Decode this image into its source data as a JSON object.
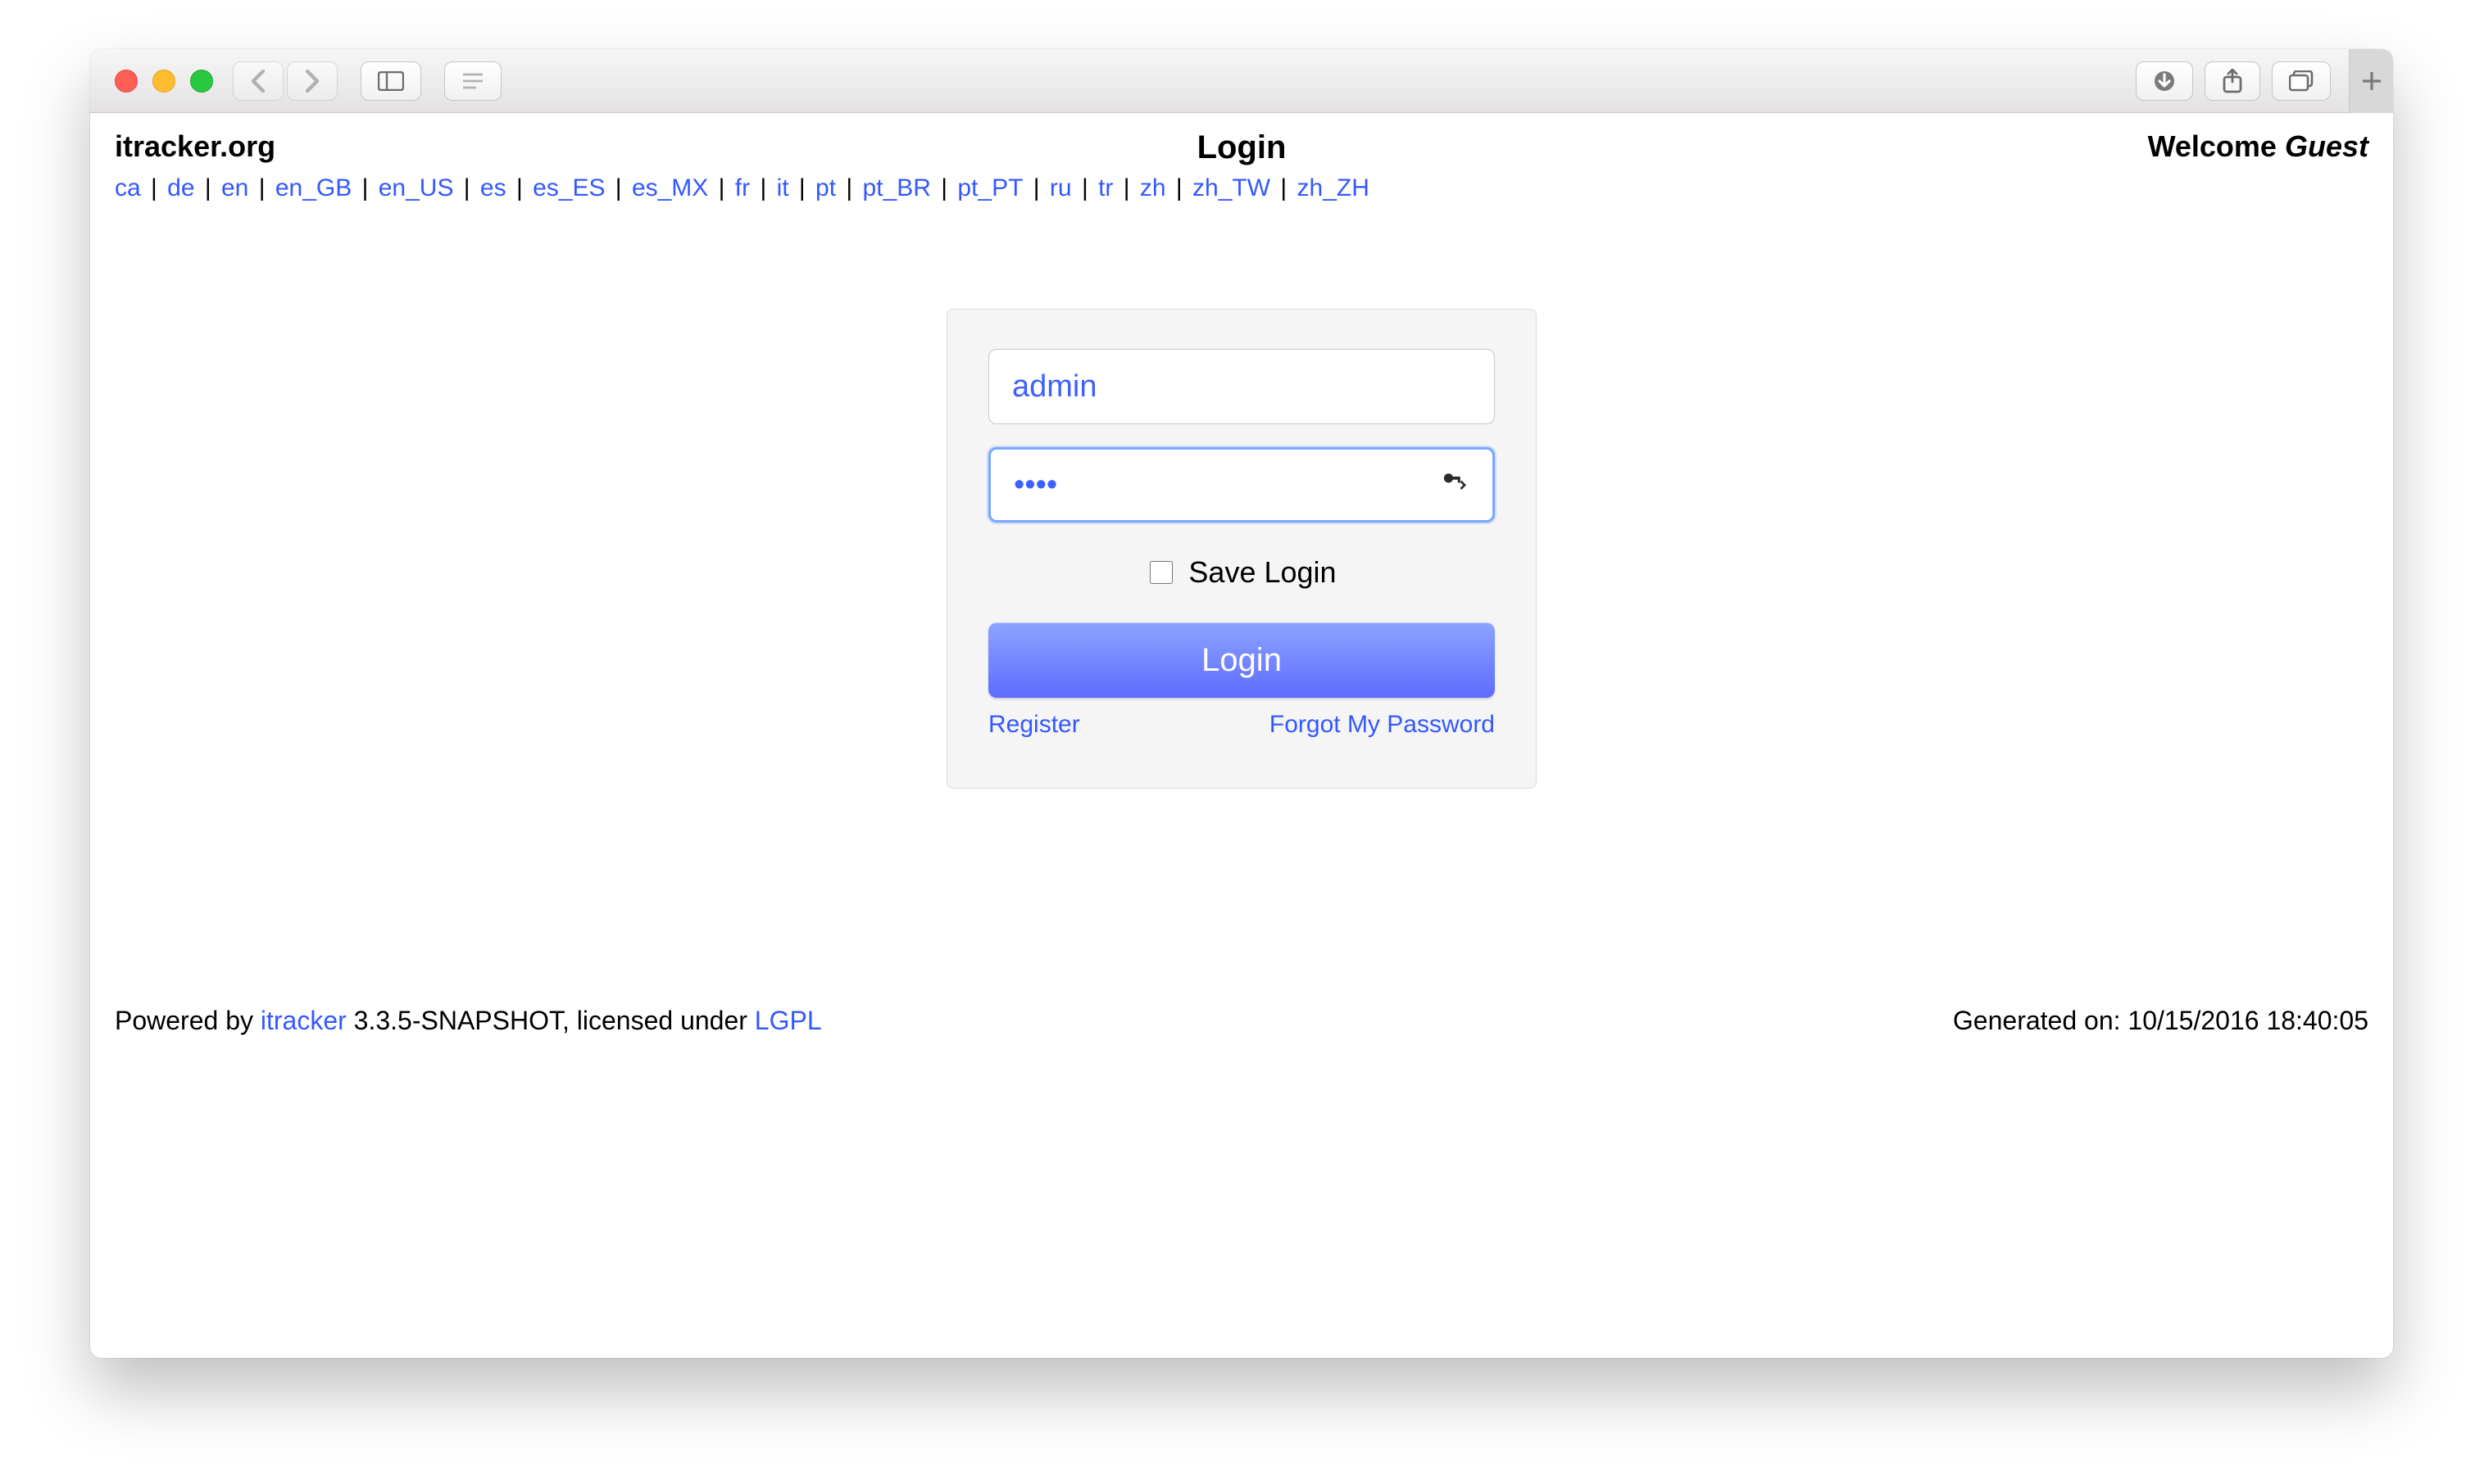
{
  "site": {
    "title": "itracker.org"
  },
  "page": {
    "title": "Login"
  },
  "welcome": {
    "prefix": "Welcome ",
    "user": "Guest"
  },
  "locales": [
    "ca",
    "de",
    "en",
    "en_GB",
    "en_US",
    "es",
    "es_ES",
    "es_MX",
    "fr",
    "it",
    "pt",
    "pt_BR",
    "pt_PT",
    "ru",
    "tr",
    "zh",
    "zh_TW",
    "zh_ZH"
  ],
  "login": {
    "username_value": "admin",
    "password_value": "••••",
    "save_label": "Save Login",
    "submit_label": "Login",
    "register_label": "Register",
    "forgot_label": "Forgot My Password"
  },
  "footer": {
    "powered_prefix": "Powered by ",
    "app_name": "itracker",
    "version_and_license": " 3.3.5-SNAPSHOT, licensed under ",
    "license_name": "LGPL",
    "generated_prefix": "Generated on: ",
    "generated_ts": "10/15/2016 18:40:05"
  }
}
